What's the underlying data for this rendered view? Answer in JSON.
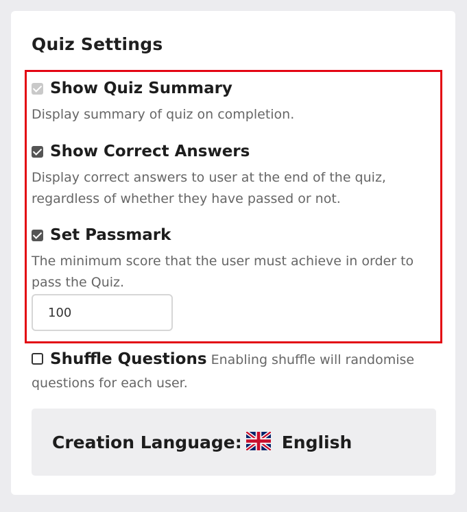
{
  "panel": {
    "title": "Quiz Settings"
  },
  "options": {
    "show_quiz_summary": {
      "label": "Show Quiz Summary",
      "description": "Display summary of quiz on completion.",
      "checked": true,
      "disabled": true
    },
    "show_correct_answers": {
      "label": "Show Correct Answers",
      "description": "Display correct answers to user at the end of the quiz, regardless of whether they have passed or not.",
      "checked": true
    },
    "set_passmark": {
      "label": "Set Passmark",
      "description": "The minimum score that the user must achieve in order to pass the Quiz.",
      "checked": true,
      "value": "100"
    },
    "shuffle_questions": {
      "label": "Shuffle Questions",
      "description": "Enabling shuffle will randomise questions for each user.",
      "checked": false
    }
  },
  "creation_language": {
    "label": "Creation Language:",
    "flag_icon": "uk-flag-icon",
    "value": "English"
  },
  "colors": {
    "highlight_border": "#e30613",
    "checkbox_checked": "#555555",
    "description_text": "#666666",
    "language_box_bg": "#eeeef0"
  }
}
